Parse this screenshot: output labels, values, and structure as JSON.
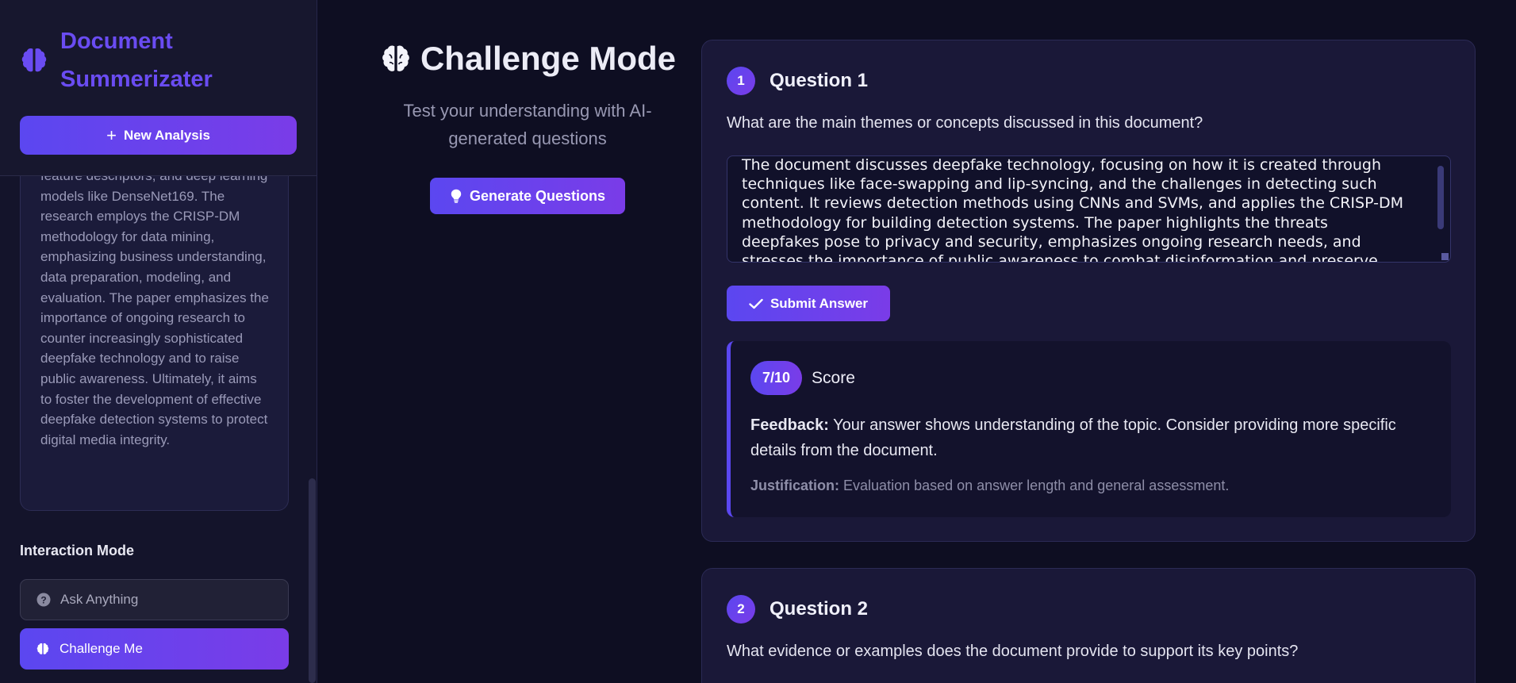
{
  "sidebar": {
    "brand": {
      "title": "Document Summerizater",
      "icon": "brain-icon",
      "color": "#6a4cf2"
    },
    "new_analysis_label": "New Analysis",
    "summary_text": "feature descriptors, and deep learning models like DenseNet169. The research employs the CRISP-DM methodology for data mining, emphasizing business understanding, data preparation, modeling, and evaluation. The paper emphasizes the importance of ongoing research to counter increasingly sophisticated deepfake technology and to raise public awareness. Ultimately, it aims to foster the development of effective deepfake detection systems to protect digital media integrity.",
    "mode_heading": "Interaction Mode",
    "modes": [
      {
        "label": "Ask Anything",
        "icon": "question-circle-icon",
        "active": false
      },
      {
        "label": "Challenge Me",
        "icon": "brain-icon",
        "active": true
      }
    ]
  },
  "intro": {
    "title": "Challenge Mode",
    "subtitle": "Test your understanding with AI-generated questions",
    "generate_label": "Generate Questions"
  },
  "questions": [
    {
      "number": "1",
      "title": "Question 1",
      "text": "What are the main themes or concepts discussed in this document?",
      "answer": "The document discusses deepfake technology, focusing on how it is created through techniques like face-swapping and lip-syncing, and the challenges in detecting such content. It reviews detection methods using CNNs and SVMs, and applies the CRISP-DM methodology for building detection systems. The paper highlights the threats deepfakes pose to privacy and security, emphasizes ongoing research needs, and stresses the importance of public awareness to combat disinformation and preserve trust in digital media.",
      "submit_label": "Submit Answer",
      "score": "7/10",
      "score_label": "Score",
      "feedback_label": "Feedback:",
      "feedback": "Your answer shows understanding of the topic. Consider providing more specific details from the document.",
      "justification_label": "Justification:",
      "justification": "Evaluation based on answer length and general assessment."
    },
    {
      "number": "2",
      "title": "Question 2",
      "text": "What evidence or examples does the document provide to support its key points?"
    }
  ],
  "colors": {
    "accent": "#5b47f0",
    "accent2": "#7a3ce8",
    "background": "#0e0e22"
  }
}
